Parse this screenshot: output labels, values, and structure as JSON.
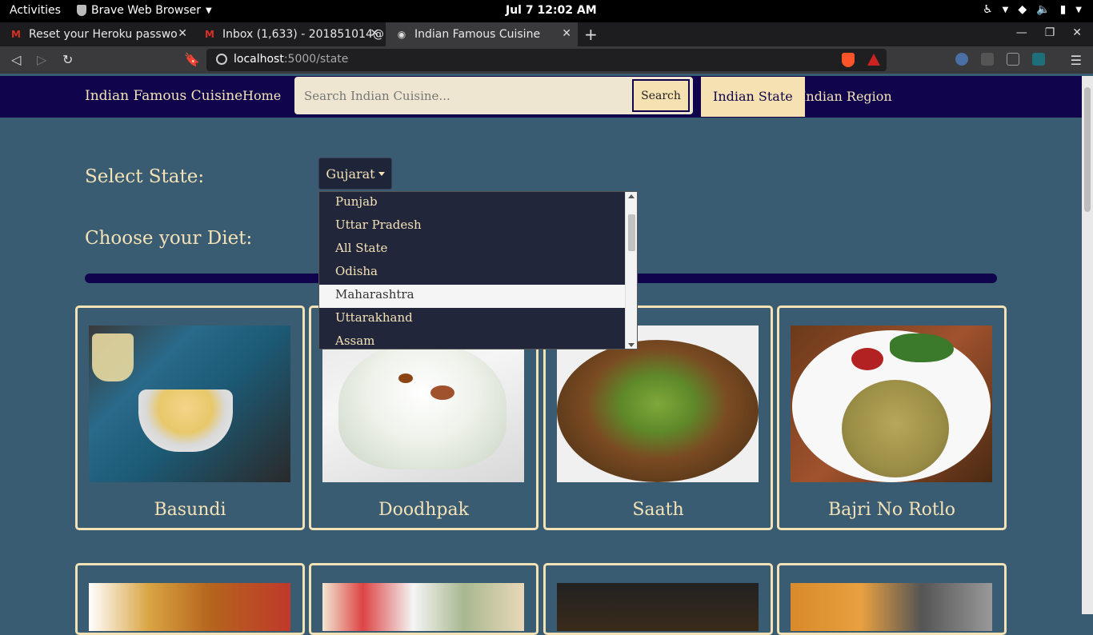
{
  "os": {
    "activities": "Activities",
    "app_name": "Brave Web Browser",
    "clock": "Jul 7  12:02 AM"
  },
  "browser": {
    "tabs": [
      {
        "label": "Reset your Heroku passwo",
        "icon": "gmail-icon"
      },
      {
        "label": "Inbox (1,633) - 201851014@",
        "icon": "gmail-icon"
      },
      {
        "label": "Indian Famous Cuisine",
        "icon": "globe-icon"
      }
    ],
    "url_host": "localhost",
    "url_path": ":5000/state"
  },
  "site": {
    "brand": "Indian Famous Cuisine",
    "home": "Home",
    "search_placeholder": "Search Indian Cuisine...",
    "search_button": "Search",
    "nav_state": "Indian State",
    "nav_region": "Indian Region"
  },
  "filters": {
    "select_state_label": "Select State:",
    "selected_state": "Gujarat",
    "diet_label": "Choose your Diet:",
    "state_options": [
      "Punjab",
      "Uttar Pradesh",
      "All State",
      "Odisha",
      "Maharashtra",
      "Uttarakhand",
      "Assam"
    ],
    "hovered_option": "Maharashtra"
  },
  "colors": {
    "page_bg": "#3a5c73",
    "nav_bg": "#10054d",
    "accent": "#f5e1b2",
    "cream_text": "#f4e2b7"
  },
  "dishes": [
    {
      "name": "Basundi"
    },
    {
      "name": "Doodhpak"
    },
    {
      "name": "Saath"
    },
    {
      "name": "Bajri No Rotlo"
    }
  ]
}
